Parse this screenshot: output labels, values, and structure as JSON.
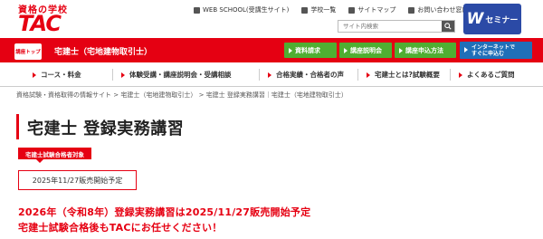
{
  "header": {
    "logo_tagline": "資格の学校",
    "logo_text": "TAC",
    "links": [
      {
        "icon": "pc-icon",
        "label": "WEB SCHOOL(受講生サイト)"
      },
      {
        "icon": "school-icon",
        "label": "学校一覧"
      },
      {
        "icon": "sitemap-icon",
        "label": "サイトマップ"
      },
      {
        "icon": "mail-icon",
        "label": "お問い合わせ窓口"
      }
    ],
    "search_placeholder": "サイト内検索",
    "wseminar_label": "セミナー",
    "wseminar_letter": "W"
  },
  "redbar": {
    "home_label": "講座トップ",
    "title": "宅建士（宅地建物取引士）",
    "buttons": [
      "資料請求",
      "講座説明会",
      "講座申込方法"
    ],
    "internet_button_line1": "インターネットで",
    "internet_button_line2": "すぐに申込む"
  },
  "nav": {
    "items": [
      "コース・料金",
      "体験受講・講座説明会・受講相談",
      "合格実績・合格者の声",
      "宅建士とは?試験概要",
      "よくあるご質問"
    ]
  },
  "breadcrumb": {
    "items": [
      "資格試験・資格取得の情報サイト",
      "宅建士（宅地建物取引士）",
      "宅建士 登録実務講習｜宅建士（宅地建物取引士）"
    ],
    "separator": ">"
  },
  "main": {
    "title": "宅建士 登録実務講習",
    "badge": "宅建士試験合格者対象",
    "notice": "2025年11/27販売開始予定",
    "message_line1": "2026年（令和8年）登録実務講習は2025/11/27販売開始予定",
    "message_line2": "宅建士試験合格後もTACにお任せください！"
  },
  "colors": {
    "brand_red": "#e60012",
    "green": "#4fae32",
    "blue": "#1f6fb8",
    "navy": "#2b4aa6"
  }
}
